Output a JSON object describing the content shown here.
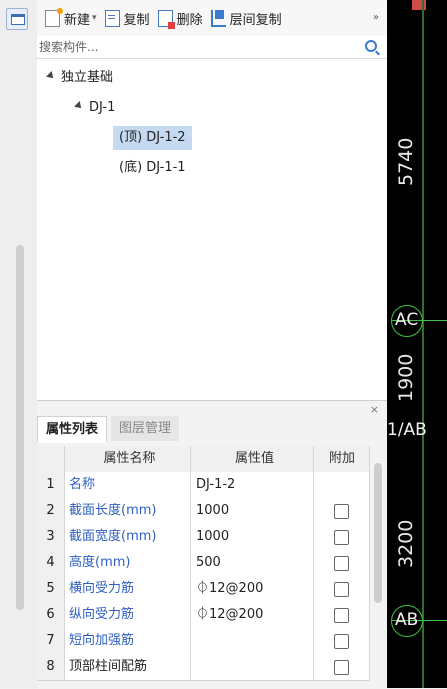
{
  "toolbar": {
    "new_label": "新建",
    "copy_label": "复制",
    "delete_label": "删除",
    "layer_copy_label": "层间复制",
    "more": "»"
  },
  "search": {
    "placeholder": "搜索构件..."
  },
  "tree": {
    "root": "独立基础",
    "child": "DJ-1",
    "leaves": [
      "(顶) DJ-1-2",
      "(底) DJ-1-1"
    ]
  },
  "properties": {
    "close": "×",
    "tabs": [
      "属性列表",
      "图层管理"
    ],
    "columns": [
      "属性名称",
      "属性值",
      "附加"
    ],
    "rows": [
      {
        "no": "1",
        "name": "名称",
        "value": "DJ-1-2",
        "blue": true
      },
      {
        "no": "2",
        "name": "截面长度(mm)",
        "value": "1000",
        "blue": true
      },
      {
        "no": "3",
        "name": "截面宽度(mm)",
        "value": "1000",
        "blue": true
      },
      {
        "no": "4",
        "name": "高度(mm)",
        "value": "500",
        "blue": true
      },
      {
        "no": "5",
        "name": "横向受力筋",
        "value": "⏀12@200",
        "blue": true
      },
      {
        "no": "6",
        "name": "纵向受力筋",
        "value": "⏀12@200",
        "blue": true
      },
      {
        "no": "7",
        "name": "短向加强筋",
        "value": "",
        "blue": true
      },
      {
        "no": "8",
        "name": "顶部柱间配筋",
        "value": "",
        "blue": false
      }
    ]
  },
  "cad": {
    "dims": [
      "5740",
      "1900",
      "3200"
    ],
    "axes": [
      "AC",
      "1/AB",
      "AB"
    ]
  }
}
